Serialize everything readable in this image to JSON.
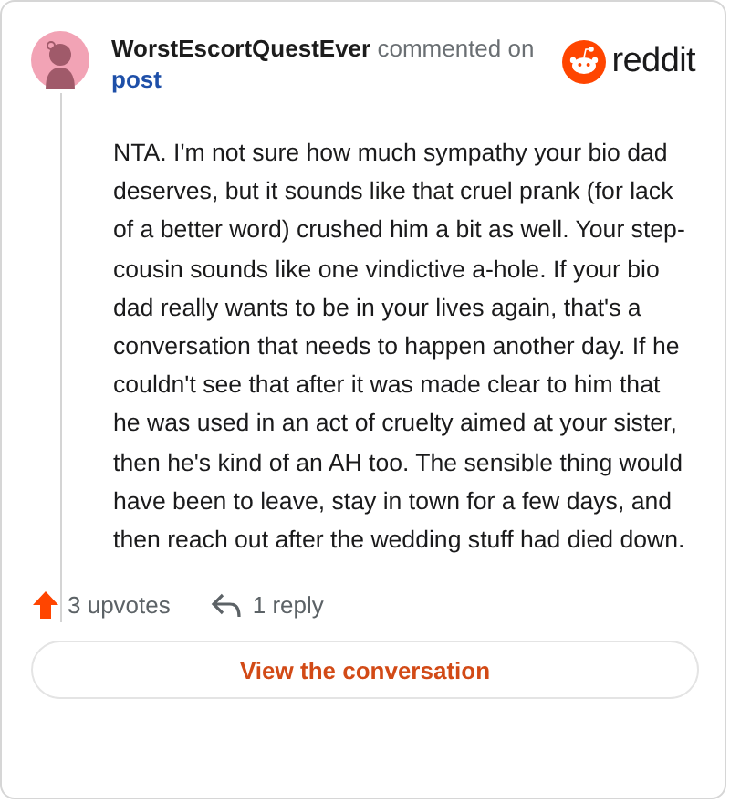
{
  "author": {
    "username": "WorstEscortQuestEver",
    "action": "commented on",
    "link": "post"
  },
  "brand": {
    "name": "reddit"
  },
  "comment": {
    "body": "NTA. I'm not sure how much sympathy your bio dad deserves, but it sounds like that cruel prank (for lack of a better word) crushed him a bit as well. Your step-cousin sounds like one vindictive a-hole. If your bio dad really wants to be in your lives again, that's a conversation that needs to happen another day. If he couldn't see that after it was made clear to him that he was used in an act of cruelty aimed at your sister, then he's kind of an AH too. The sensible thing would have been to leave, stay in town for a few days, and then reach out after the wedding stuff had died down."
  },
  "stats": {
    "upvotes": "3 upvotes",
    "replies": "1 reply"
  },
  "button": {
    "label": "View the conversation"
  }
}
